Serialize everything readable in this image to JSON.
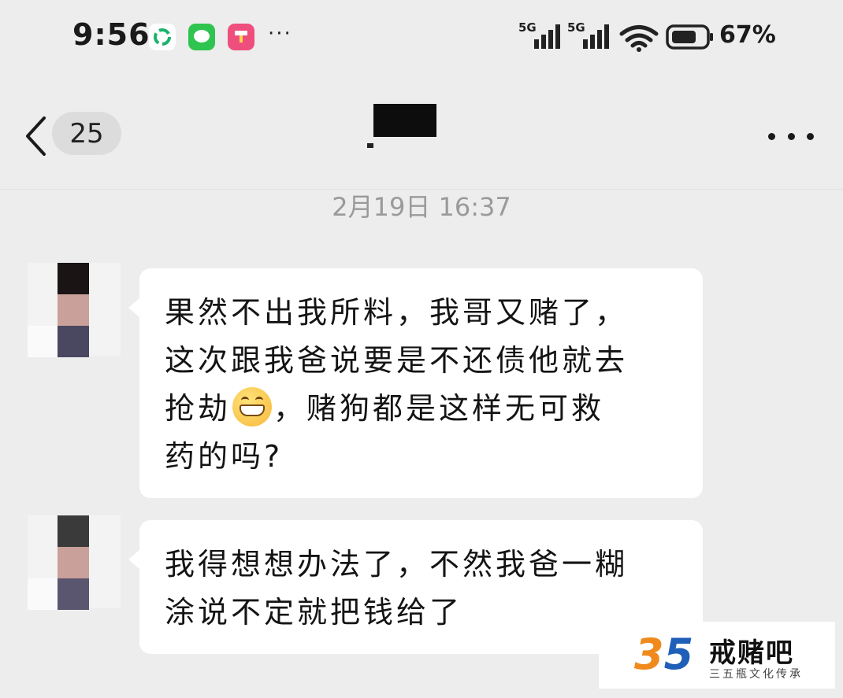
{
  "status_bar": {
    "time": "9:56",
    "signal_1": "5G",
    "signal_2": "5G",
    "battery": "67%",
    "more": "···"
  },
  "header": {
    "unread_count": "25",
    "contact_name": ""
  },
  "timestamp": "2月19日 16:37",
  "messages": [
    {
      "line1": "果然不出我所料，我哥又赌了，",
      "line2": "这次跟我爸说要是不还债他就去",
      "line3_pre": "抢劫",
      "line3_emoji": "grinning-face",
      "line3_post": "，赌狗都是这样无可救",
      "line4": "药的吗?"
    },
    {
      "line1": "我得想想办法了，不然我爸一糊",
      "line2": "涂说不定就把钱给了"
    }
  ],
  "watermark": {
    "digit_3": "3",
    "digit_5": "5",
    "title": "戒赌吧",
    "subtitle": "三五瓶文化传承"
  },
  "colors": {
    "background": "#ededed",
    "bubble": "#ffffff",
    "timestamp": "#9a9a9a",
    "avatar_top": "#1a1414",
    "avatar_mid": "#c9a09a",
    "avatar_bottom": "#4a4760"
  }
}
